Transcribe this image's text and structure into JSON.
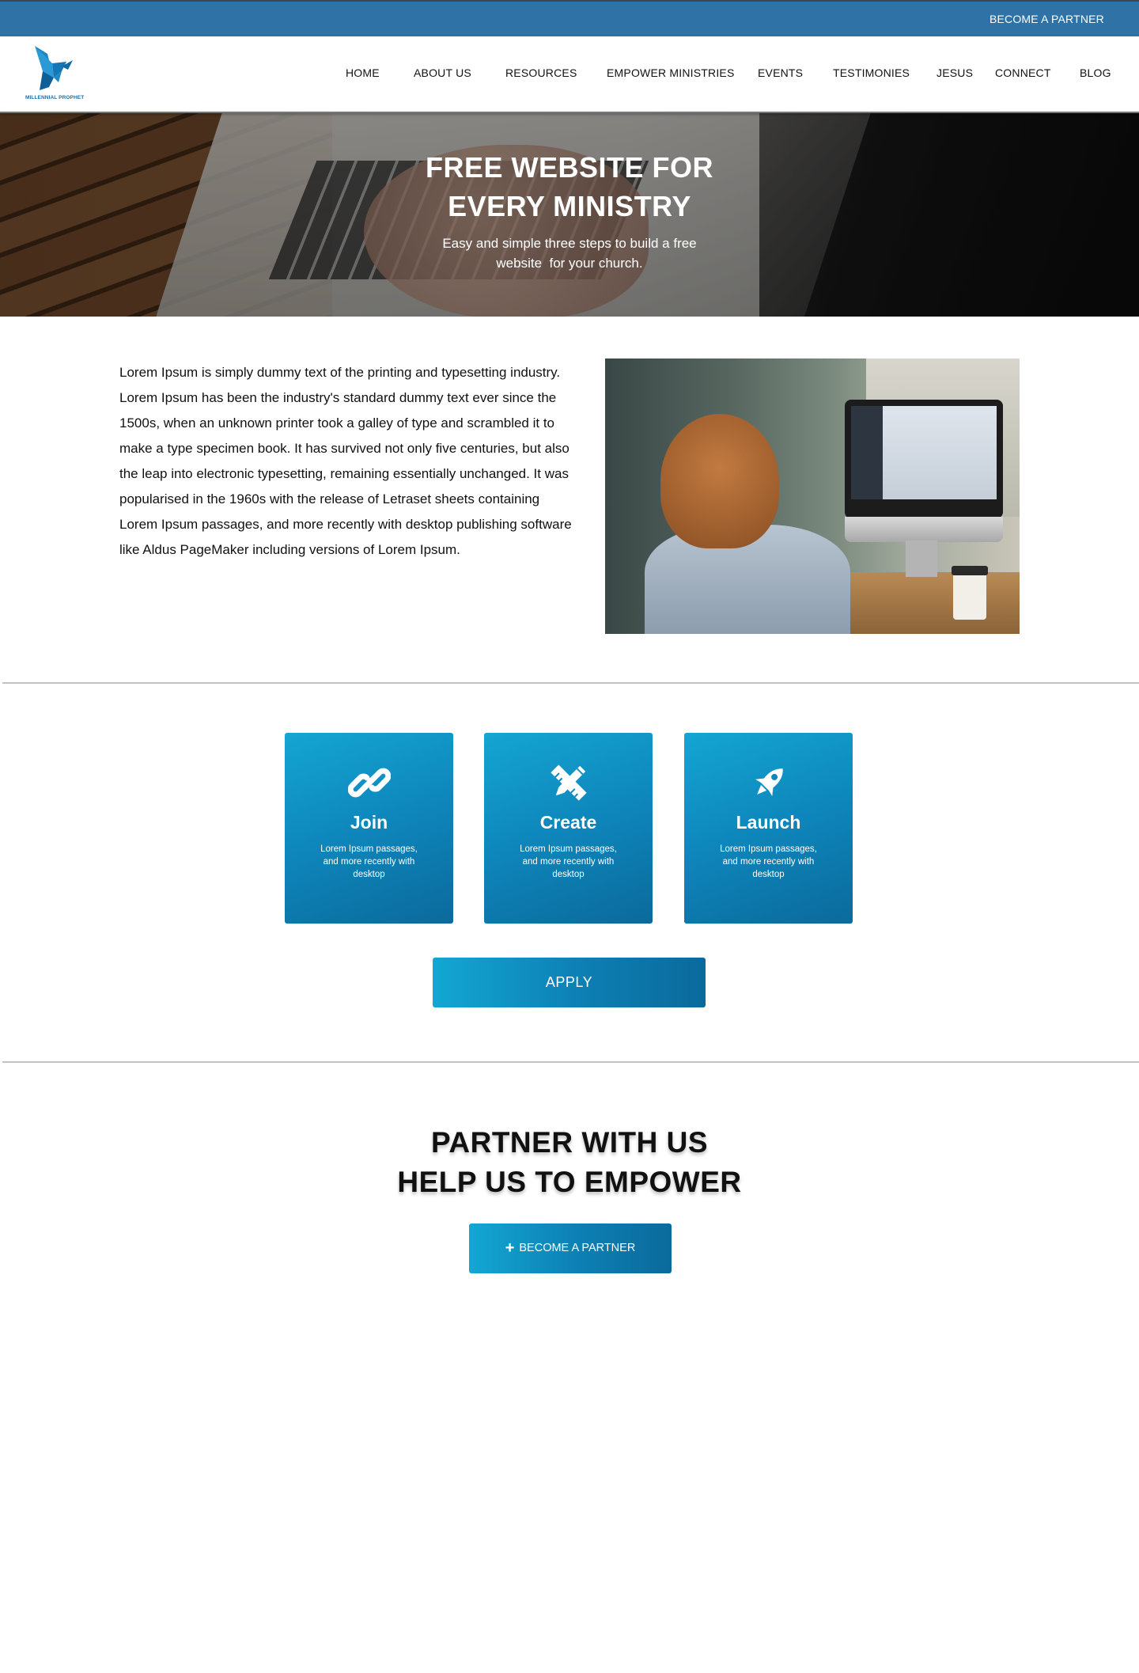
{
  "topbar": {
    "become_partner": "BECOME A PARTNER"
  },
  "logo": {
    "text": "MILLENNIAL PROPHET"
  },
  "nav": {
    "items": [
      {
        "label": "HOME"
      },
      {
        "label": "ABOUT US"
      },
      {
        "label": "RESOURCES"
      },
      {
        "label": "EMPOWER MINISTRIES"
      },
      {
        "label": "EVENTS"
      },
      {
        "label": "TESTIMONIES"
      },
      {
        "label": "JESUS"
      },
      {
        "label": "CONNECT"
      },
      {
        "label": "BLOG"
      }
    ]
  },
  "hero": {
    "title_line1": "FREE WEBSITE FOR",
    "title_line2": "EVERY MINISTRY",
    "subtitle_line1": "Easy and simple three steps to build a free",
    "subtitle_line2": "website  for your church."
  },
  "intro": {
    "paragraph": "Lorem Ipsum is simply dummy text of the printing and typesetting industry. Lorem Ipsum has been the industry's standard dummy text ever since the 1500s, when an unknown printer took a galley of type and scrambled it to make a type specimen book. It has survived not only five centuries, but also the leap into electronic typesetting, remaining essentially unchanged. It was popularised in the 1960s with the release of Letraset sheets containing Lorem Ipsum passages, and more recently with desktop publishing software like Aldus PageMaker including versions of Lorem Ipsum."
  },
  "steps": [
    {
      "title": "Join",
      "text": "Lorem Ipsum passages, and more recently with desktop",
      "icon": "link-icon"
    },
    {
      "title": "Create",
      "text": "Lorem Ipsum passages, and more recently with desktop",
      "icon": "pencil-ruler-icon"
    },
    {
      "title": "Launch",
      "text": "Lorem Ipsum passages, and more recently with desktop",
      "icon": "rocket-icon"
    }
  ],
  "apply": {
    "label": "APPLY"
  },
  "partner": {
    "title_line1": "PARTNER WITH US",
    "title_line2": "HELP US TO EMPOWER",
    "button_label": "BECOME A PARTNER",
    "button_icon": "plus-icon"
  },
  "colors": {
    "topbar": "#2e72a6",
    "accent": "#0e86bb",
    "accent_light": "#14a6d2",
    "accent_dark": "#0b6a9c"
  }
}
